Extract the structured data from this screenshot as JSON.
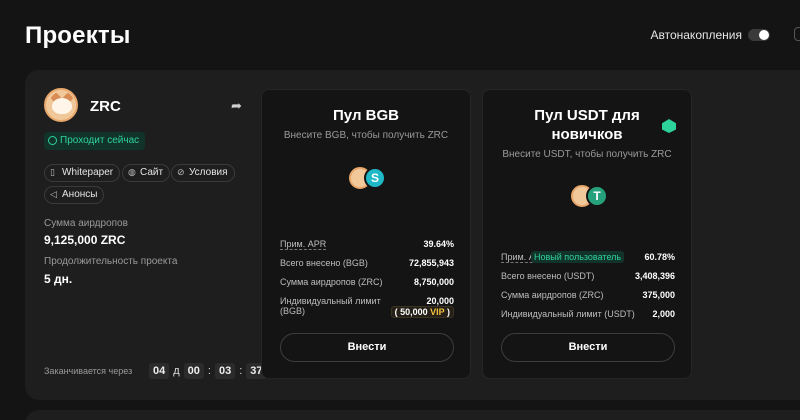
{
  "header": {
    "title": "Проекты",
    "auto_label": "Автонакопления",
    "auto_enabled": false
  },
  "project": {
    "name": "ZRC",
    "status": "Проходит сейчас",
    "links": [
      "Whitepaper",
      "Сайт",
      "Условия",
      "Анонсы"
    ],
    "airdrop_label": "Сумма аирдропов",
    "airdrop_value": "9,125,000 ZRC",
    "duration_label": "Продолжительность проекта",
    "duration_value": "5 дн.",
    "ends_label": "Заканчивается через",
    "timer": {
      "days": "04",
      "days_unit": "д",
      "hours": "00",
      "minutes": "03",
      "seconds": "37"
    }
  },
  "pools": [
    {
      "title": "Пул BGB",
      "subtitle": "Внесите BGB, чтобы получить ZRC",
      "apr_label": "Прим. APR",
      "apr_value": "39.64%",
      "total_label": "Всего внесено (BGB)",
      "total_value": "72,855,943",
      "airdrop_label": "Сумма аирдропов (ZRC)",
      "airdrop_value": "8,750,000",
      "limit_label_1": "Индивидуальный лимит",
      "limit_label_2": "(BGB)",
      "limit_value": "20,000",
      "vip_value": "( 50,000",
      "vip_label": "VIP",
      "vip_close": ")",
      "button": "Внести"
    },
    {
      "title_line1": "Пул USDT для",
      "title_line2": "новичков",
      "subtitle": "Внесите USDT, чтобы получить ZRC",
      "apr_label": "Прим. APR",
      "new_user_badge": "Новый пользователь",
      "apr_value": "60.78%",
      "total_label": "Всего внесено (USDT)",
      "total_value": "3,408,396",
      "airdrop_label": "Сумма аирдропов (ZRC)",
      "airdrop_value": "375,000",
      "limit_label": "Индивидуальный лимит (USDT)",
      "limit_value": "2,000",
      "button": "Внести"
    }
  ],
  "colors": {
    "accent_green": "#2ed39b",
    "vip_gold": "#f3c13a",
    "bgb_coin": "#1fb8c7",
    "usdt_coin": "#26a17b"
  },
  "icons": [
    "share-icon",
    "clock-icon",
    "document-icon",
    "globe-icon",
    "link-icon",
    "megaphone-icon",
    "gem-icon"
  ]
}
